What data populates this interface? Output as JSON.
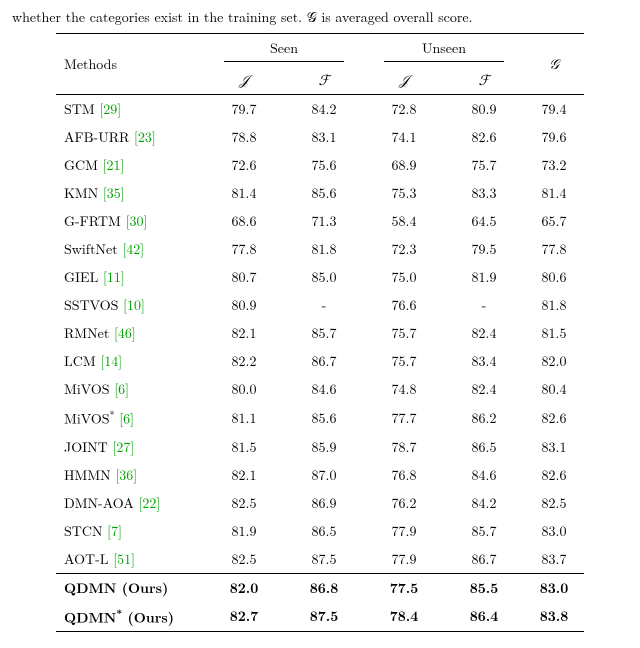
{
  "caption": "whether the categories exist in the training set. 𝒢 is averaged overall score.",
  "header": {
    "methods": "Methods",
    "seen": "Seen",
    "unseen": "Unseen",
    "g": "𝒢",
    "j": "𝒥",
    "f": "ℱ"
  },
  "rows": [
    {
      "name": "STM",
      "cite": "[29]",
      "star": false,
      "sj": "79.7",
      "sf": "84.2",
      "uj": "72.8",
      "uf": "80.9",
      "g": "79.4"
    },
    {
      "name": "AFB-URR",
      "cite": "[23]",
      "star": false,
      "sj": "78.8",
      "sf": "83.1",
      "uj": "74.1",
      "uf": "82.6",
      "g": "79.6"
    },
    {
      "name": "GCM",
      "cite": "[21]",
      "star": false,
      "sj": "72.6",
      "sf": "75.6",
      "uj": "68.9",
      "uf": "75.7",
      "g": "73.2"
    },
    {
      "name": "KMN",
      "cite": "[35]",
      "star": false,
      "sj": "81.4",
      "sf": "85.6",
      "uj": "75.3",
      "uf": "83.3",
      "g": "81.4"
    },
    {
      "name": "G-FRTM",
      "cite": "[30]",
      "star": false,
      "sj": "68.6",
      "sf": "71.3",
      "uj": "58.4",
      "uf": "64.5",
      "g": "65.7"
    },
    {
      "name": "SwiftNet",
      "cite": "[42]",
      "star": false,
      "sj": "77.8",
      "sf": "81.8",
      "uj": "72.3",
      "uf": "79.5",
      "g": "77.8"
    },
    {
      "name": "GIEL",
      "cite": "[11]",
      "star": false,
      "sj": "80.7",
      "sf": "85.0",
      "uj": "75.0",
      "uf": "81.9",
      "g": "80.6"
    },
    {
      "name": "SSTVOS",
      "cite": "[10]",
      "star": false,
      "sj": "80.9",
      "sf": "-",
      "uj": "76.6",
      "uf": "-",
      "g": "81.8"
    },
    {
      "name": "RMNet",
      "cite": "[46]",
      "star": false,
      "sj": "82.1",
      "sf": "85.7",
      "uj": "75.7",
      "uf": "82.4",
      "g": "81.5"
    },
    {
      "name": "LCM",
      "cite": "[14]",
      "star": false,
      "sj": "82.2",
      "sf": "86.7",
      "uj": "75.7",
      "uf": "83.4",
      "g": "82.0"
    },
    {
      "name": "MiVOS",
      "cite": "[6]",
      "star": false,
      "sj": "80.0",
      "sf": "84.6",
      "uj": "74.8",
      "uf": "82.4",
      "g": "80.4"
    },
    {
      "name": "MiVOS",
      "cite": "[6]",
      "star": true,
      "sj": "81.1",
      "sf": "85.6",
      "uj": "77.7",
      "uf": "86.2",
      "g": "82.6"
    },
    {
      "name": "JOINT",
      "cite": "[27]",
      "star": false,
      "sj": "81.5",
      "sf": "85.9",
      "uj": "78.7",
      "uf": "86.5",
      "g": "83.1"
    },
    {
      "name": "HMMN",
      "cite": "[36]",
      "star": false,
      "sj": "82.1",
      "sf": "87.0",
      "uj": "76.8",
      "uf": "84.6",
      "g": "82.6"
    },
    {
      "name": "DMN-AOA",
      "cite": "[22]",
      "star": false,
      "sj": "82.5",
      "sf": "86.9",
      "uj": "76.2",
      "uf": "84.2",
      "g": "82.5"
    },
    {
      "name": "STCN",
      "cite": "[7]",
      "star": false,
      "sj": "81.9",
      "sf": "86.5",
      "uj": "77.9",
      "uf": "85.7",
      "g": "83.0"
    },
    {
      "name": "AOT-L",
      "cite": "[51]",
      "star": false,
      "sj": "82.5",
      "sf": "87.5",
      "uj": "77.9",
      "uf": "86.7",
      "g": "83.7"
    }
  ],
  "ours": [
    {
      "name": "QDMN (Ours)",
      "star": false,
      "sj": "82.0",
      "sf": "86.8",
      "uj": "77.5",
      "uf": "85.5",
      "g": "83.0"
    },
    {
      "name": "QDMN",
      "suffix": " (Ours)",
      "star": true,
      "sj": "82.7",
      "sf": "87.5",
      "uj": "78.4",
      "uf": "86.4",
      "g": "83.8"
    }
  ],
  "chart_data": {
    "type": "table",
    "title": "Comparison of methods on Seen vs Unseen categories (J, F) and overall G",
    "columns": [
      "Method",
      "Seen J",
      "Seen F",
      "Unseen J",
      "Unseen F",
      "G"
    ],
    "rows": [
      [
        "STM [29]",
        79.7,
        84.2,
        72.8,
        80.9,
        79.4
      ],
      [
        "AFB-URR [23]",
        78.8,
        83.1,
        74.1,
        82.6,
        79.6
      ],
      [
        "GCM [21]",
        72.6,
        75.6,
        68.9,
        75.7,
        73.2
      ],
      [
        "KMN [35]",
        81.4,
        85.6,
        75.3,
        83.3,
        81.4
      ],
      [
        "G-FRTM [30]",
        68.6,
        71.3,
        58.4,
        64.5,
        65.7
      ],
      [
        "SwiftNet [42]",
        77.8,
        81.8,
        72.3,
        79.5,
        77.8
      ],
      [
        "GIEL [11]",
        80.7,
        85.0,
        75.0,
        81.9,
        80.6
      ],
      [
        "SSTVOS [10]",
        80.9,
        null,
        76.6,
        null,
        81.8
      ],
      [
        "RMNet [46]",
        82.1,
        85.7,
        75.7,
        82.4,
        81.5
      ],
      [
        "LCM [14]",
        82.2,
        86.7,
        75.7,
        83.4,
        82.0
      ],
      [
        "MiVOS [6]",
        80.0,
        84.6,
        74.8,
        82.4,
        80.4
      ],
      [
        "MiVOS* [6]",
        81.1,
        85.6,
        77.7,
        86.2,
        82.6
      ],
      [
        "JOINT [27]",
        81.5,
        85.9,
        78.7,
        86.5,
        83.1
      ],
      [
        "HMMN [36]",
        82.1,
        87.0,
        76.8,
        84.6,
        82.6
      ],
      [
        "DMN-AOA [22]",
        82.5,
        86.9,
        76.2,
        84.2,
        82.5
      ],
      [
        "STCN [7]",
        81.9,
        86.5,
        77.9,
        85.7,
        83.0
      ],
      [
        "AOT-L [51]",
        82.5,
        87.5,
        77.9,
        86.7,
        83.7
      ],
      [
        "QDMN (Ours)",
        82.0,
        86.8,
        77.5,
        85.5,
        83.0
      ],
      [
        "QDMN* (Ours)",
        82.7,
        87.5,
        78.4,
        86.4,
        83.8
      ]
    ]
  }
}
